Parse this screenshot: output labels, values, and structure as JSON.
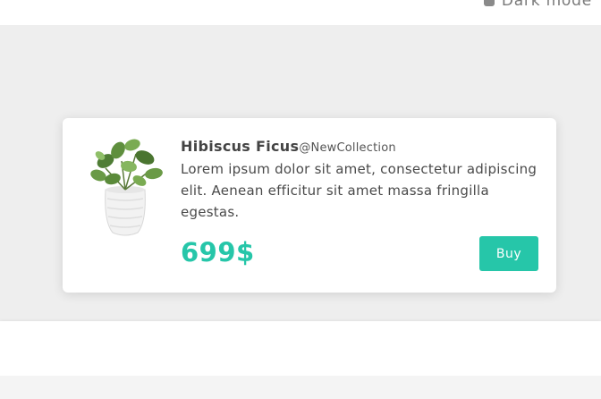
{
  "header": {
    "dark_mode_label": "Dark mode",
    "dark_mode_icon": "toggle-icon"
  },
  "product": {
    "name": "Hibiscus Ficus",
    "collection": "@NewCollection",
    "description": "Lorem ipsum dolor sit amet, consectetur adipiscing elit. Aenean efficitur sit amet massa fringilla egestas.",
    "price": "699$",
    "buy_label": "Buy",
    "image_icon": "potted-plant-image"
  },
  "colors": {
    "accent": "#26c6a9",
    "stage_background": "#eeeeee",
    "card_background": "#ffffff",
    "text_primary": "#444444"
  }
}
